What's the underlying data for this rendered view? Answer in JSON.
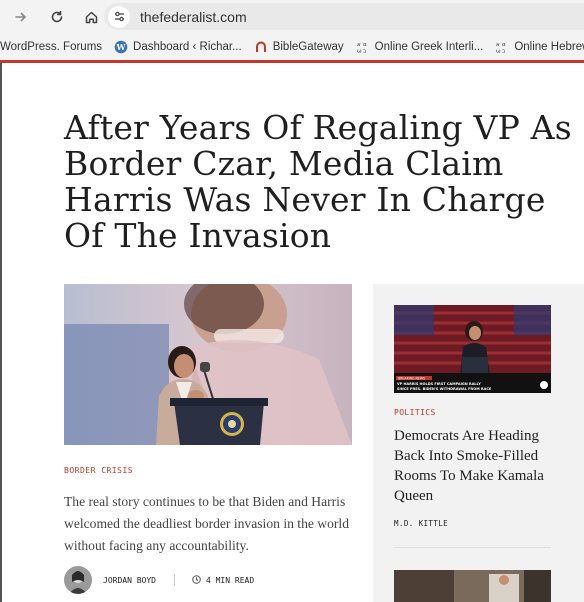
{
  "browser": {
    "url": "thefederalist.com",
    "icons": {
      "forward": "arrow-right-icon",
      "reload": "reload-icon",
      "home": "home-icon",
      "site_settings": "tune-icon"
    },
    "bookmarks": [
      {
        "label": "WordPress. Forums",
        "icon": "none"
      },
      {
        "label": "Dashboard ‹ Richar...",
        "icon": "wordpress-icon"
      },
      {
        "label": "BibleGateway",
        "icon": "biblegateway-icon"
      },
      {
        "label": "Online Greek Interli...",
        "icon": "scripture-icon"
      },
      {
        "label": "Online Hebrew Inter...",
        "icon": "scripture-icon"
      }
    ]
  },
  "article": {
    "title": "After Years Of Regaling VP As Border Czar, Media Claim Harris Was Never In Charge Of The Invasion",
    "category": "BORDER CRISIS",
    "excerpt": "The real story continues to be that Biden and Harris welcomed the deadliest border invasion in the world without facing any accountability.",
    "author": "JORDAN BOYD",
    "read_time": "4 MIN READ"
  },
  "sidebar": {
    "thumb_caption_1": "BREAKING NEWS",
    "thumb_caption_2": "VP HARRIS HOLDS FIRST CAMPAIGN RALLY",
    "thumb_caption_3": "SINCE PRES. BIDEN'S WITHDRAWAL FROM RACE",
    "category": "POLITICS",
    "title": "Democrats Are Heading Back Into Smoke-Filled Rooms To Make Kamala Queen",
    "author": "M.D. KITTLE"
  },
  "colors": {
    "accent": "#c0392b",
    "sidebar_bg": "#f2f2f2",
    "chrome_bg": "#f3f3f3"
  }
}
